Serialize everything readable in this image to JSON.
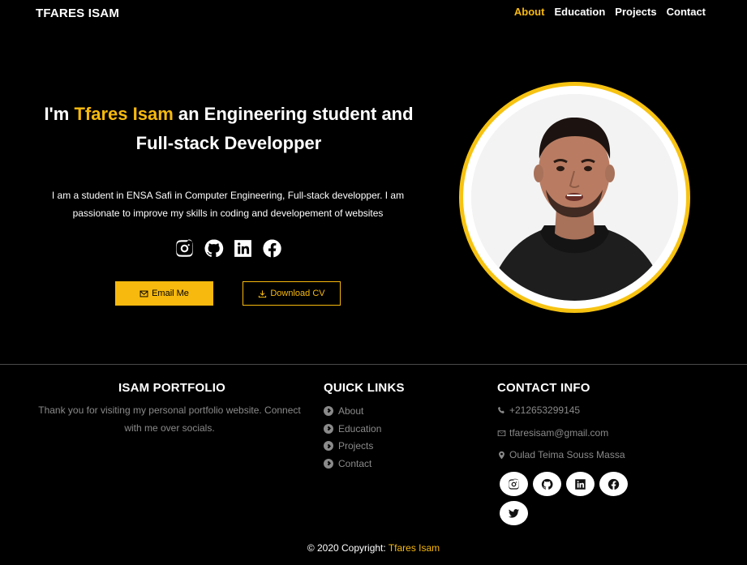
{
  "nav": {
    "brand": "TFARES ISAM",
    "links": [
      "About",
      "Education",
      "Projects",
      "Contact"
    ],
    "active": "About"
  },
  "hero": {
    "title_prefix": "I'm ",
    "name": "Tfares Isam",
    "title_suffix": " an Engineering student and Full-stack Developper",
    "description": "I am a student in ENSA Safi in Computer Engineering, Full-stack developper. I am passionate to improve my skills in coding and developement of websites",
    "social_icons": [
      "instagram-icon",
      "github-icon",
      "linkedin-icon",
      "facebook-icon"
    ],
    "email_button": "Email Me",
    "cv_button": "Download CV"
  },
  "footer": {
    "portfolio_title": "ISAM PORTFOLIO",
    "portfolio_text": "Thank you for visiting my personal portfolio website. Connect with me over socials.",
    "quick_links_title": "QUICK LINKS",
    "quick_links": [
      "About",
      "Education",
      "Projects",
      "Contact"
    ],
    "contact_title": "CONTACT INFO",
    "phone": "+212653299145",
    "email": "tfaresisam@gmail.com",
    "location": "Oulad Teima Souss Massa",
    "social_icons": [
      "instagram-icon",
      "github-icon",
      "linkedin-icon",
      "facebook-icon",
      "twitter-icon"
    ],
    "copyright_prefix": "© 2020 Copyright: ",
    "copyright_owner": "Tfares Isam"
  },
  "colors": {
    "accent": "#f7b90d",
    "background": "#000000",
    "muted_text": "#8a8a8a"
  }
}
